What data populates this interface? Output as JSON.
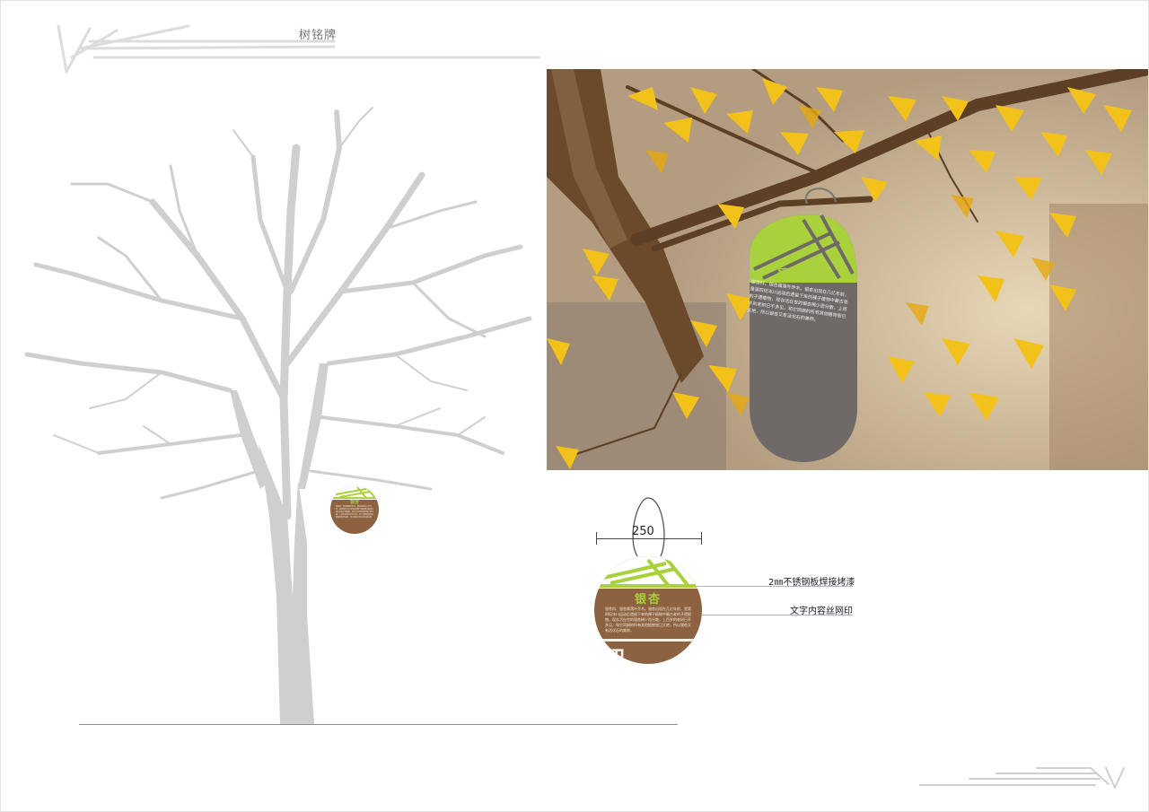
{
  "page": {
    "title": "树铭牌"
  },
  "sign": {
    "name": "银杏",
    "text": "银杏科、银杏属落叶乔木。银杏出现在几亿年前，是第四纪冰川运动后遗留下来的裸子植物中最古老的孑遗植物，现存活在世的银杏稀少而分散，上百岁的老树已不多见，和它同纲的所有其他植物皆已灭绝，所以银杏又有活化石的美称。",
    "motif": "初"
  },
  "dimensions": {
    "width_label": "250"
  },
  "callouts": [
    {
      "label": "2㎜不锈钢板焊接烤漆"
    },
    {
      "label": "文字内容丝网印"
    }
  ],
  "colors": {
    "tree_silhouette": "#cfcfcf",
    "sign_green": "#a9d13b",
    "sign_brown": "#8c6241",
    "sign_photo_gray": "#6f6a68",
    "ginkgo_yellow": "#f3c21a",
    "callout_line": "#7fc7cf"
  }
}
